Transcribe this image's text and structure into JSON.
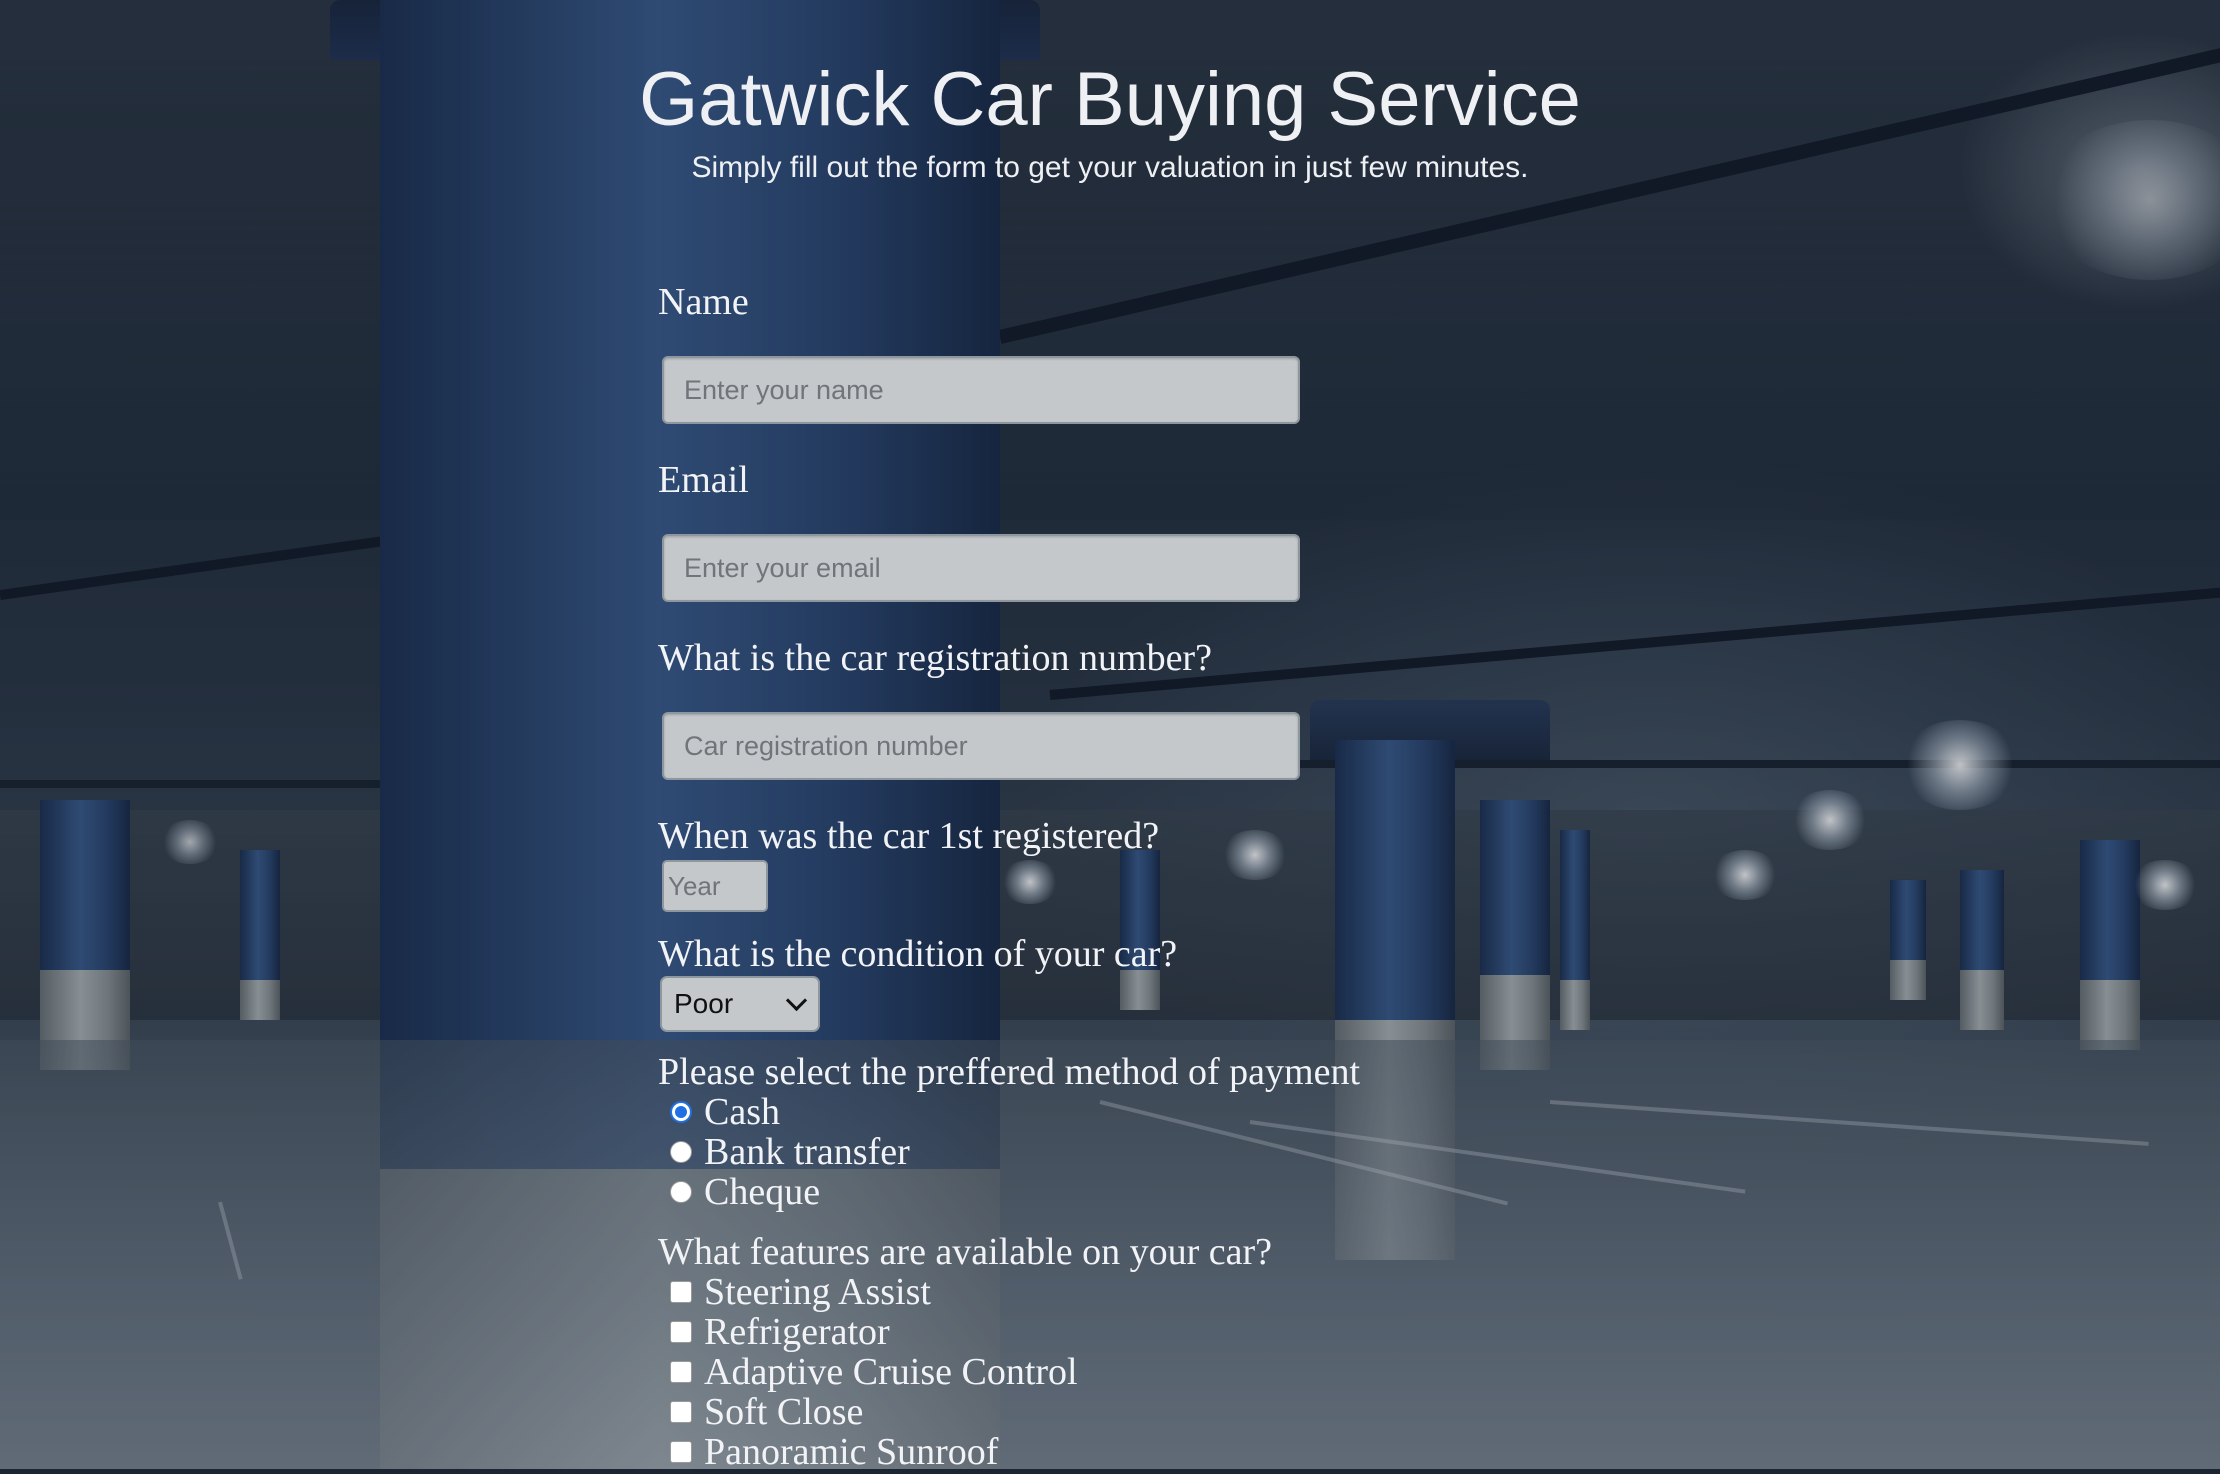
{
  "header": {
    "title": "Gatwick Car Buying Service",
    "subtitle": "Simply fill out the form to get your valuation in just few minutes."
  },
  "form": {
    "name": {
      "label": "Name",
      "placeholder": "Enter your name",
      "value": ""
    },
    "email": {
      "label": "Email",
      "placeholder": "Enter your email",
      "value": ""
    },
    "registration": {
      "label": "What is the car registration number?",
      "placeholder": "Car registration number",
      "value": ""
    },
    "first_registered": {
      "label": "When was the car 1st registered?",
      "placeholder": "Year",
      "value": ""
    },
    "condition": {
      "label": "What is the condition of your car?",
      "selected": "Poor"
    },
    "payment": {
      "label": "Please select the preffered method of payment",
      "options": [
        "Cash",
        "Bank transfer",
        "Cheque"
      ],
      "selected": "Cash"
    },
    "features": {
      "label": "What features are available on your car?",
      "options": [
        "Steering Assist",
        "Refrigerator",
        "Adaptive Cruise Control",
        "Soft Close",
        "Panoramic Sunroof"
      ]
    }
  },
  "colors": {
    "radio_accent": "#1f6fe5",
    "input_bg": "#c4c8cb",
    "text": "#f2f3f6"
  }
}
